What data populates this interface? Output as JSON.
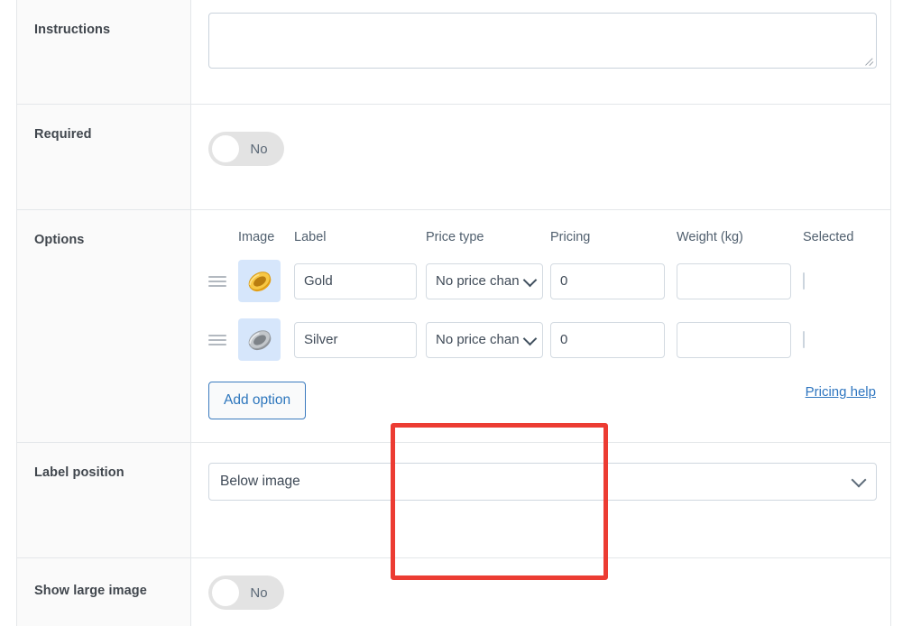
{
  "rows": {
    "instructions": {
      "label": "Instructions",
      "textarea_value": "",
      "textarea_placeholder": ""
    },
    "required": {
      "label": "Required",
      "toggle_state": "No"
    },
    "options": {
      "label": "Options"
    },
    "label_position": {
      "label": "Label position",
      "selected": "Below image"
    },
    "show_large_image": {
      "label": "Show large image",
      "toggle_state": "No"
    }
  },
  "options_table": {
    "headers": {
      "image": "Image",
      "label": "Label",
      "price_type": "Price type",
      "pricing": "Pricing",
      "weight": "Weight (kg)",
      "selected": "Selected"
    },
    "rows": [
      {
        "image_icon": "gold-ring-icon",
        "label": "Gold",
        "price_type": "No price change",
        "pricing": "0",
        "weight": "",
        "selected": false
      },
      {
        "image_icon": "silver-ring-icon",
        "label": "Silver",
        "price_type": "No price change",
        "pricing": "0",
        "weight": "",
        "selected": false
      }
    ],
    "add_option_label": "Add option",
    "pricing_help_label": "Pricing help"
  },
  "colors": {
    "highlight_box": "#ec3c33",
    "link": "#2f76c0",
    "button_border": "#3b7bbf",
    "thumb_background": "#d6e6fb",
    "label_background": "#fafafa",
    "border": "#e4e7ea"
  }
}
